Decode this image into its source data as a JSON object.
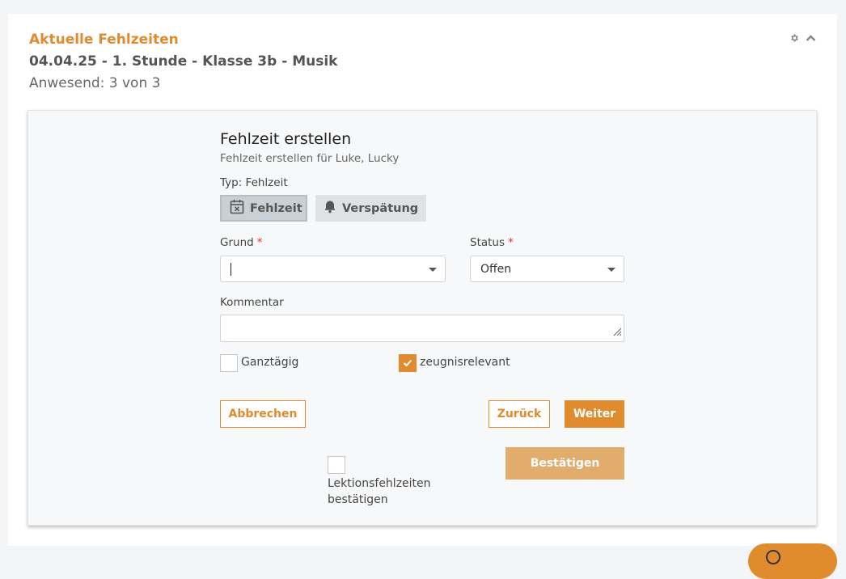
{
  "header": {
    "title": "Aktuelle Fehlzeiten",
    "lesson": "04.04.25 - 1. Stunde - Klasse 3b - Musik",
    "presence": "Anwesend: 3 von 3"
  },
  "form": {
    "title": "Fehlzeit erstellen",
    "subtitle": "Fehlzeit erstellen für Luke, Lucky",
    "type_label": "Typ: Fehlzeit",
    "type_buttons": [
      {
        "label": "Fehlzeit",
        "icon": "calendar-x-icon",
        "active": true
      },
      {
        "label": "Verspätung",
        "icon": "bell-icon",
        "active": false
      }
    ],
    "grund": {
      "label": "Grund",
      "required_mark": "*",
      "value": ""
    },
    "status": {
      "label": "Status",
      "required_mark": "*",
      "value": "Offen"
    },
    "kommentar": {
      "label": "Kommentar",
      "value": ""
    },
    "checkboxes": {
      "ganztaegig": {
        "label": "Ganztägig",
        "checked": false
      },
      "zeugnisrelevant": {
        "label": "zeugnisrelevant",
        "checked": true
      },
      "lektion": {
        "label_line1": "Lektionsfehlzeiten",
        "label_line2": "bestätigen",
        "checked": false
      }
    },
    "buttons": {
      "cancel": "Abbrechen",
      "back": "Zurück",
      "next": "Weiter",
      "confirm": "Bestätigen"
    }
  },
  "colors": {
    "accent": "#e08b2e",
    "accent_disabled": "#e2ac6d",
    "active_type_bg": "#c9d1d6",
    "required": "#e0302a"
  }
}
